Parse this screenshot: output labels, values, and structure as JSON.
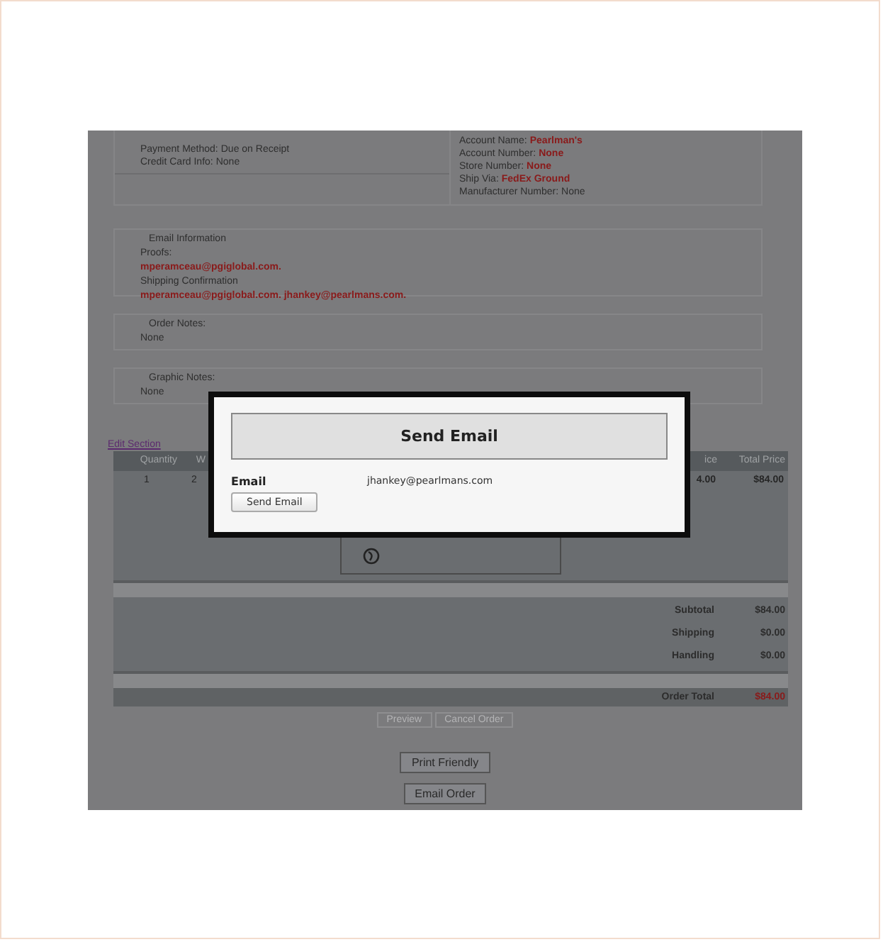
{
  "order_info": {
    "left": [
      {
        "label": "Payment Method:",
        "value": "Due on Receipt",
        "highlight": false
      },
      {
        "label": "Credit Card Info:",
        "value": "None",
        "highlight": false
      }
    ],
    "right": [
      {
        "label": "Account Name:",
        "value": "Pearlman's",
        "highlight": true
      },
      {
        "label": "Account Number:",
        "value": "None",
        "highlight": true
      },
      {
        "label": "Store Number:",
        "value": "None",
        "highlight": true
      },
      {
        "label": "Ship Via:",
        "value": "FedEx Ground",
        "highlight": true
      },
      {
        "label": "Manufacturer Number:",
        "value": "None",
        "highlight": false
      }
    ]
  },
  "email_information": {
    "legend": "Email Information",
    "groups": [
      {
        "label": "Proofs:",
        "value": "mperamceau@pgiglobal.com."
      },
      {
        "label": "Shipping Confirmation",
        "value": "mperamceau@pgiglobal.com. jhankey@pearlmans.com."
      }
    ]
  },
  "notes": [
    {
      "legend": "Order Notes:",
      "value": "None"
    },
    {
      "legend": "Graphic Notes:",
      "value": "None"
    }
  ],
  "edit_link": "Edit Section",
  "table": {
    "columns": [
      "Quantity",
      "W",
      "ice",
      "Total Price"
    ],
    "rows": [
      {
        "cells": [
          "1",
          "2",
          "4.00",
          "$84.00"
        ]
      }
    ]
  },
  "totals": [
    {
      "label": "Subtotal",
      "value": "$84.00"
    },
    {
      "label": "Shipping",
      "value": "$0.00"
    },
    {
      "label": "Handling",
      "value": "$0.00"
    }
  ],
  "order_total": {
    "label": "Order Total",
    "value": "$84.00"
  },
  "disabled_buttons": [
    "Preview",
    "Cancel Order"
  ],
  "buttons": [
    "Print Friendly",
    "Email Order"
  ],
  "dialog": {
    "title": "Send Email",
    "field_label": "Email",
    "field_value": "jhankey@pearlmans.com",
    "button": "Send Email"
  }
}
